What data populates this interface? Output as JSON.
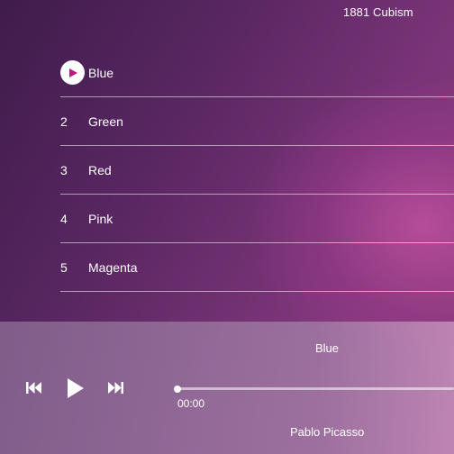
{
  "album": {
    "title": "1881 Cubism"
  },
  "tracks": [
    {
      "number": "",
      "name": "Blue",
      "playing": true
    },
    {
      "number": "2",
      "name": "Green"
    },
    {
      "number": "3",
      "name": "Red"
    },
    {
      "number": "4",
      "name": "Pink"
    },
    {
      "number": "5",
      "name": "Magenta"
    }
  ],
  "player": {
    "now_playing": "Blue",
    "artist": "Pablo Picasso",
    "elapsed": "00:00",
    "progress": 0,
    "controls": [
      "previous-icon",
      "play-icon",
      "next-icon"
    ]
  },
  "colors": {
    "accent": "#c2187a"
  }
}
